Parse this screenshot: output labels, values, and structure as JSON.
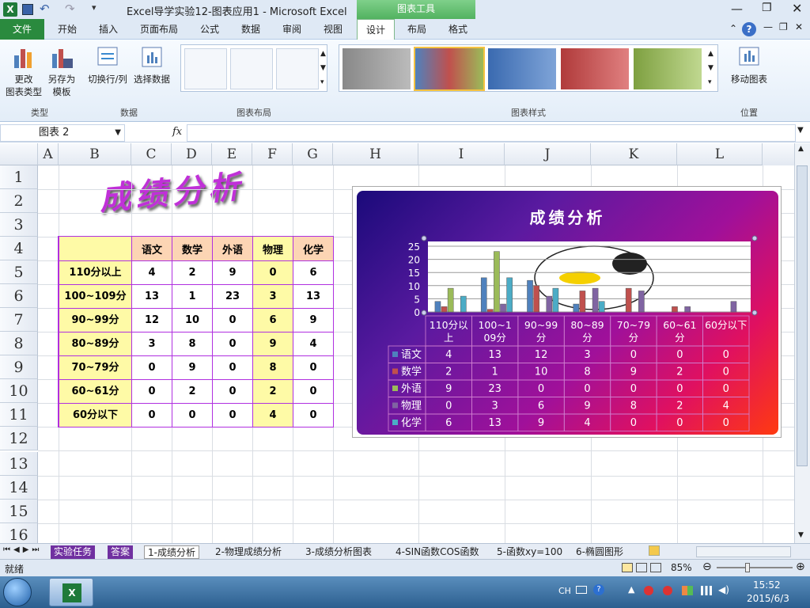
{
  "window": {
    "title": "Excel导学实验12-图表应用1 - Microsoft Excel",
    "context_tools": "图表工具"
  },
  "tabs": [
    "文件",
    "开始",
    "插入",
    "页面布局",
    "公式",
    "数据",
    "审阅",
    "视图",
    "设计",
    "布局",
    "格式"
  ],
  "ribbon": {
    "change_type": [
      "更改",
      "图表类型"
    ],
    "save_template": [
      "另存为",
      "模板"
    ],
    "switch_rowcol": "切换行/列",
    "select_data": "选择数据",
    "move_chart": "移动图表",
    "groups": [
      "类型",
      "数据",
      "图表布局",
      "图表样式",
      "位置"
    ]
  },
  "formula_bar": {
    "name_box": "图表 2",
    "fx": "fx",
    "formula": ""
  },
  "columns": [
    "A",
    "B",
    "C",
    "D",
    "E",
    "F",
    "G",
    "H",
    "I",
    "J",
    "K",
    "L"
  ],
  "rows": [
    "1",
    "2",
    "3",
    "4",
    "5",
    "6",
    "7",
    "8",
    "9",
    "10",
    "11",
    "12",
    "13",
    "14",
    "15",
    "16"
  ],
  "sheet": {
    "title_art": "成绩分析",
    "table": {
      "headers": [
        "语文",
        "数学",
        "外语",
        "物理",
        "化学"
      ],
      "rows": [
        {
          "label": "110分以上",
          "values": [
            "4",
            "2",
            "9",
            "0",
            "6"
          ]
        },
        {
          "label": "100~109分",
          "values": [
            "13",
            "1",
            "23",
            "3",
            "13"
          ]
        },
        {
          "label": "90~99分",
          "values": [
            "12",
            "10",
            "0",
            "6",
            "9"
          ]
        },
        {
          "label": "80~89分",
          "values": [
            "3",
            "8",
            "0",
            "9",
            "4"
          ]
        },
        {
          "label": "70~79分",
          "values": [
            "0",
            "9",
            "0",
            "8",
            "0"
          ]
        },
        {
          "label": "60~61分",
          "values": [
            "0",
            "2",
            "0",
            "2",
            "0"
          ]
        },
        {
          "label": "60分以下",
          "values": [
            "0",
            "0",
            "0",
            "4",
            "0"
          ]
        }
      ]
    }
  },
  "chart_data": {
    "type": "bar",
    "title": "成绩分析",
    "categories": [
      "110分以上",
      "100~109分",
      "90~99分",
      "80~89分",
      "70~79分",
      "60~61分",
      "60分以下"
    ],
    "yticks": [
      "25",
      "20",
      "15",
      "10",
      "5",
      "0"
    ],
    "ylim": [
      0,
      25
    ],
    "series": [
      {
        "name": "语文",
        "values": [
          4,
          13,
          12,
          3,
          0,
          0,
          0
        ],
        "color": "#4f81bd"
      },
      {
        "name": "数学",
        "values": [
          2,
          1,
          10,
          8,
          9,
          2,
          0
        ],
        "color": "#c0504d"
      },
      {
        "name": "外语",
        "values": [
          9,
          23,
          0,
          0,
          0,
          0,
          0
        ],
        "color": "#9bbb59"
      },
      {
        "name": "物理",
        "values": [
          0,
          3,
          6,
          9,
          8,
          2,
          4
        ],
        "color": "#8064a2"
      },
      {
        "name": "化学",
        "values": [
          6,
          13,
          9,
          4,
          0,
          0,
          0
        ],
        "color": "#4bacc6"
      }
    ],
    "data_table": true
  },
  "sheet_tabs": [
    "实验任务",
    "答案",
    "1-成绩分析",
    "2-物理成绩分析",
    "3-成绩分析图表",
    "4-SIN函数COS函数",
    "5-函数xy=100",
    "6-椭圆图形"
  ],
  "status": {
    "ready": "就绪",
    "zoom": "85%"
  },
  "taskbar": {
    "lang": "CH",
    "time": "15:52",
    "date": "2015/6/3"
  }
}
